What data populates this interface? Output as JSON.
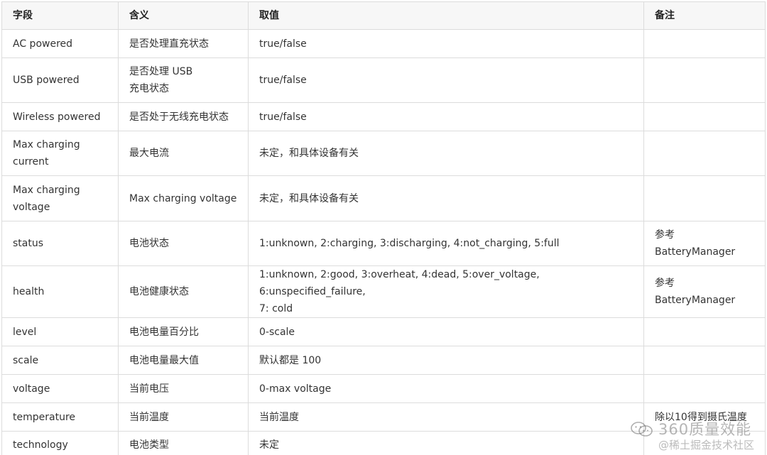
{
  "table": {
    "headers": [
      "字段",
      "含义",
      "取值",
      "备注"
    ],
    "rows": [
      {
        "field": "AC powered",
        "meaning": "是否处理直充状态",
        "value": "true/false",
        "note": ""
      },
      {
        "field": "USB powered",
        "meaning": "是否处理 USB\n充电状态",
        "value": "true/false",
        "note": ""
      },
      {
        "field": "Wireless powered",
        "meaning": "是否处于无线充电状态",
        "value": "true/false",
        "note": ""
      },
      {
        "field": "Max charging\ncurrent",
        "meaning": "最大电流",
        "value": "未定，和具体设备有关",
        "note": ""
      },
      {
        "field": "Max charging\nvoltage",
        "meaning": "Max charging voltage",
        "value": "未定，和具体设备有关",
        "note": ""
      },
      {
        "field": "status",
        "meaning": "电池状态",
        "value": "1:unknown, 2:charging, 3:discharging, 4:not_charging, 5:full",
        "note": "参考\nBatteryManager"
      },
      {
        "field": "health",
        "meaning": "电池健康状态",
        "value": "1:unknown, 2:good, 3:overheat, 4:dead, 5:over_voltage, 6:unspecified_failure,\n7: cold",
        "note": "参考\nBatteryManager"
      },
      {
        "field": "level",
        "meaning": "电池电量百分比",
        "value": "0-scale",
        "note": ""
      },
      {
        "field": "scale",
        "meaning": "电池电量最大值",
        "value": "默认都是 100",
        "note": ""
      },
      {
        "field": "voltage",
        "meaning": "当前电压",
        "value": "0-max voltage",
        "note": ""
      },
      {
        "field": "temperature",
        "meaning": "当前温度",
        "value": "当前温度",
        "note": "除以10得到摄氏温度"
      },
      {
        "field": "technology",
        "meaning": "电池类型",
        "value": "未定",
        "note": ""
      }
    ]
  },
  "watermark": {
    "brand": "360质量效能",
    "sub": "@稀土掘金技术社区",
    "icon": "wechat-icon"
  }
}
